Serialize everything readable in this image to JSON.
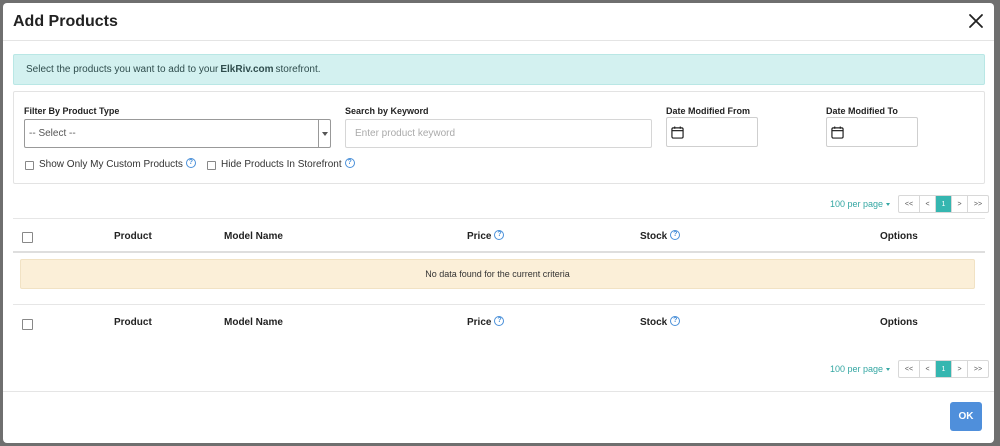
{
  "modal": {
    "title": "Add Products",
    "close_icon": "close-icon"
  },
  "alert": {
    "prefix": "Select the products you want to add to your",
    "store_name": "ElkRiv.com",
    "suffix": "storefront."
  },
  "filters": {
    "product_type_label": "Filter By Product Type",
    "product_type_value": "-- Select --",
    "keyword_label": "Search by Keyword",
    "keyword_placeholder": "Enter product keyword",
    "date_from_label": "Date Modified From",
    "date_to_label": "Date Modified To",
    "custom_products_label": "Show Only My Custom Products",
    "hide_products_label": "Hide Products In Storefront"
  },
  "pagination": {
    "per_page": "100 per page",
    "first": "<<",
    "prev": "<",
    "current": "1",
    "next": ">",
    "last": ">>"
  },
  "table": {
    "columns": {
      "product": "Product",
      "model_name": "Model Name",
      "price": "Price",
      "stock": "Stock",
      "options": "Options"
    },
    "empty_message": "No data found for the current criteria",
    "rows": []
  },
  "footer": {
    "ok_label": "OK"
  },
  "colors": {
    "accent": "#35b6b0",
    "ok_button": "#4f8fdb",
    "alert_bg": "#d3f1f0",
    "empty_bg": "#fbefd8"
  }
}
